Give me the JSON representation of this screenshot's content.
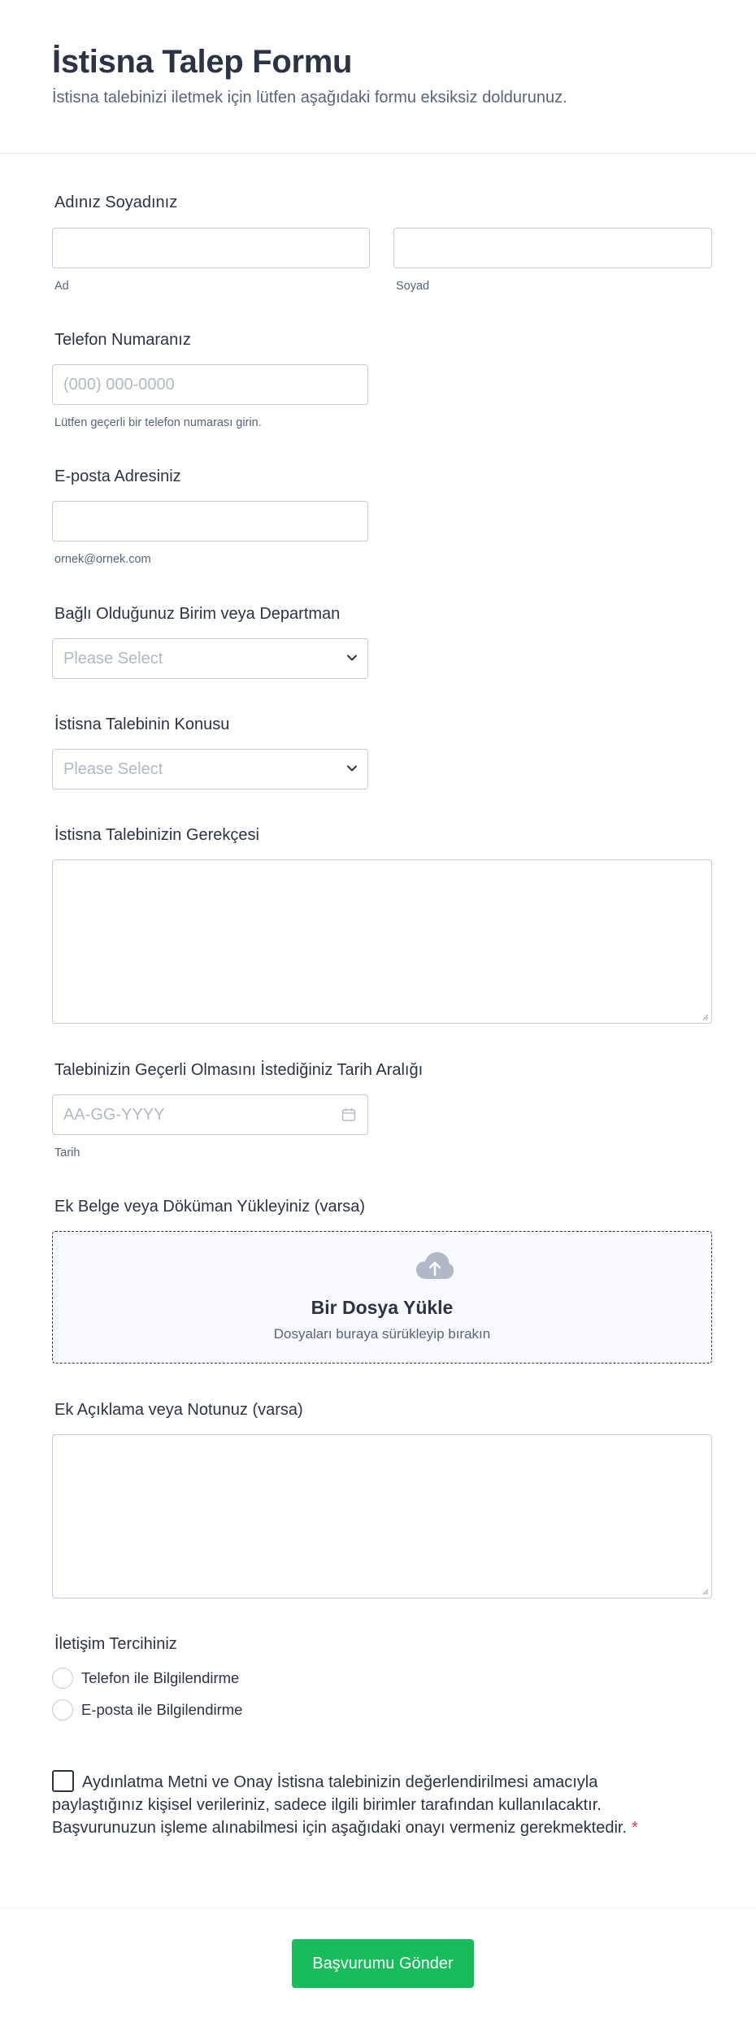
{
  "form": {
    "title": "İstisna Talep Formu",
    "subtitle": "İstisna talebinizi iletmek için lütfen aşağıdaki formu eksiksiz doldurunuz."
  },
  "name": {
    "label": "Adınız Soyadınız",
    "first_value": "",
    "first_sublabel": "Ad",
    "last_value": "",
    "last_sublabel": "Soyad"
  },
  "phone": {
    "label": "Telefon Numaranız",
    "placeholder": "(000) 000-0000",
    "sublabel": "Lütfen geçerli bir telefon numarası girin."
  },
  "email": {
    "label": "E-posta Adresiniz",
    "value": "",
    "sublabel": "ornek@ornek.com"
  },
  "department": {
    "label": "Bağlı Olduğunuz Birim veya Departman",
    "selected": "Please Select"
  },
  "subject": {
    "label": "İstisna Talebinin Konusu",
    "selected": "Please Select"
  },
  "reason": {
    "label": "İstisna Talebinizin Gerekçesi"
  },
  "date_range": {
    "label": "Talebinizin Geçerli Olmasını İstediğiniz Tarih Aralığı",
    "placeholder": "AA-GG-YYYY",
    "sublabel": "Tarih"
  },
  "upload": {
    "label": "Ek Belge veya Döküman Yükleyiniz (varsa)",
    "title": "Bir Dosya Yükle",
    "hint": "Dosyaları buraya sürükleyip bırakın",
    "icon": "cloud-upload-icon"
  },
  "notes": {
    "label": "Ek Açıklama veya Notunuz (varsa)"
  },
  "contact": {
    "label": "İletişim Tercihiniz",
    "options": [
      "Telefon ile Bilgilendirme",
      "E-posta ile Bilgilendirme"
    ]
  },
  "consent": {
    "text": "Aydınlatma Metni ve Onay İstisna talebinizin değerlendirilmesi amacıyla paylaştığınız kişisel verileriniz, sadece ilgili birimler tarafından kullanılacaktır. Başvurunuzun işleme alınabilmesi için aşağıdaki onayı vermeniz gerekmektedir.",
    "required_mark": "*"
  },
  "submit": {
    "label": "Başvurumu Gönder",
    "color": "#18bd5b"
  },
  "colors": {
    "text": "#2c3345",
    "muted": "#57647e",
    "border": "#c3cad8",
    "placeholder": "#b2b8c6",
    "required": "#f23a3c"
  }
}
